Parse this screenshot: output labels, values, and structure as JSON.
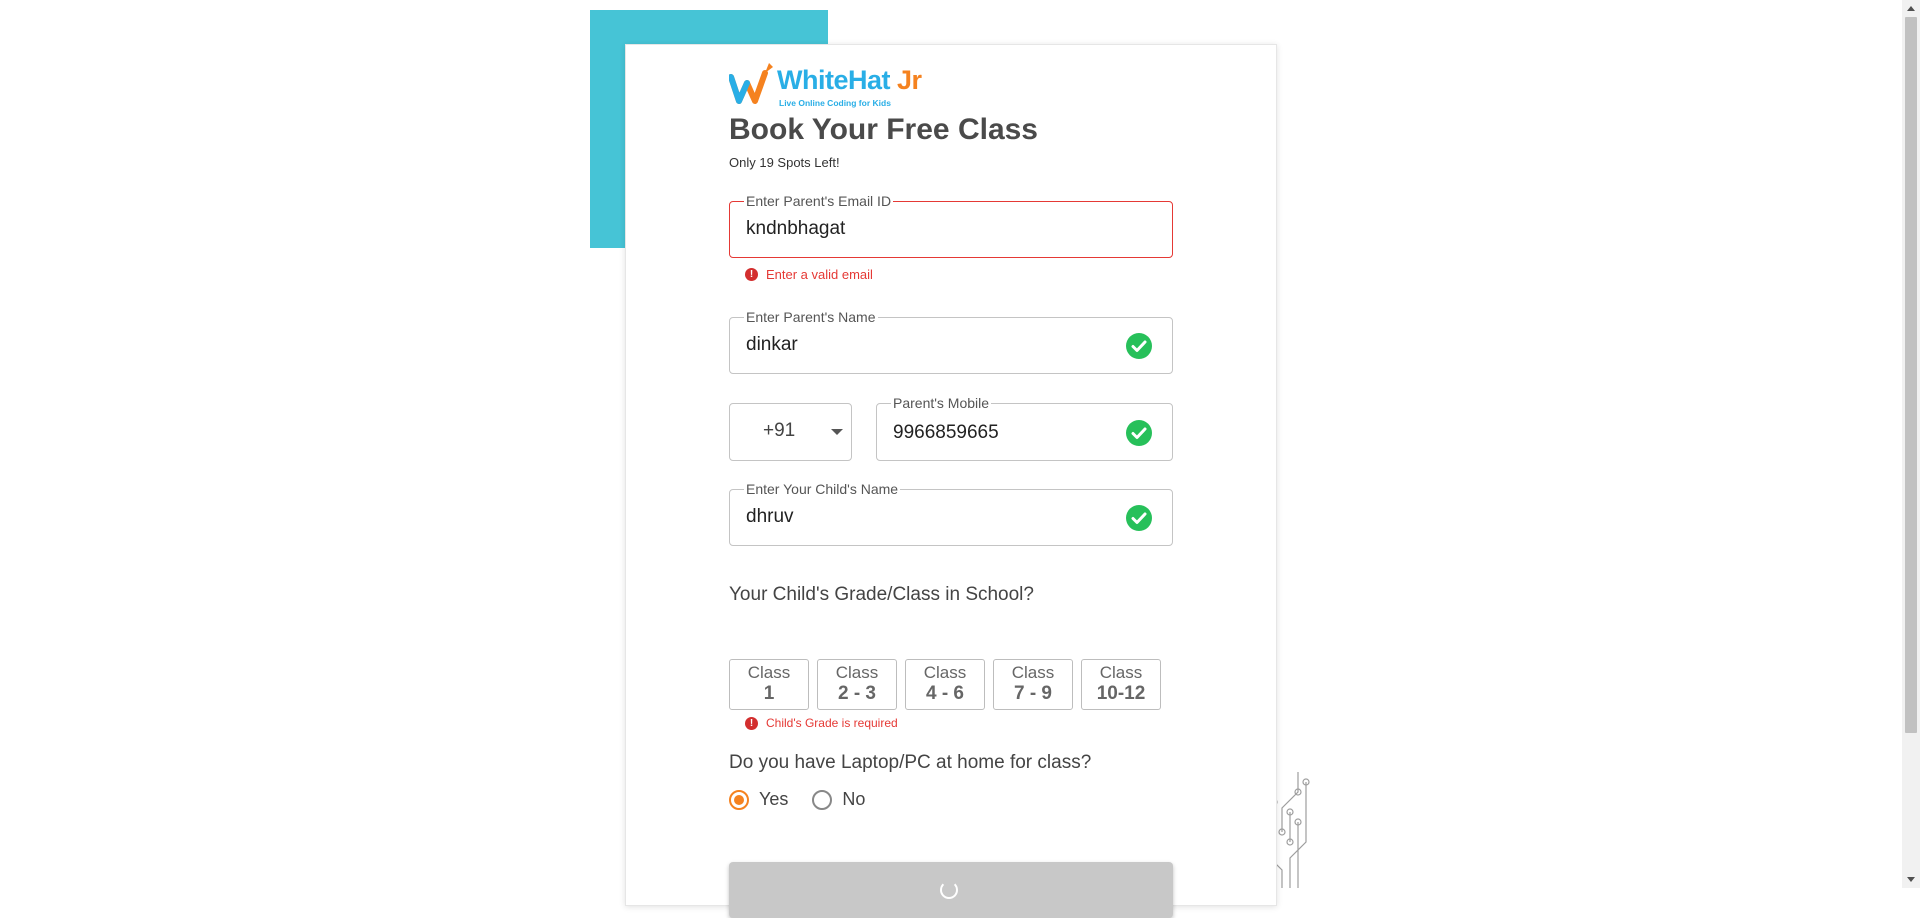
{
  "brand": {
    "name_main": "WhiteHat",
    "name_accent": "Jr",
    "tagline": "Live Online Coding for Kids",
    "primary_color": "#29aee6",
    "accent_color": "#f5821f",
    "teal_color": "#46c4d6"
  },
  "form": {
    "title": "Book Your Free Class",
    "subtitle": "Only 19 Spots Left!",
    "email": {
      "label": "Enter Parent's Email ID",
      "value": "kndnbhagat",
      "error": "Enter a valid email"
    },
    "parent_name": {
      "label": "Enter Parent's Name",
      "value": "dinkar",
      "valid": true
    },
    "country_code": {
      "value": "+91"
    },
    "mobile": {
      "label": "Parent's Mobile",
      "value": "9966859665",
      "valid": true
    },
    "child_name": {
      "label": "Enter Your Child's Name",
      "value": "dhruv",
      "valid": true
    },
    "grade": {
      "question": "Your Child's Grade/Class in School?",
      "options": [
        {
          "line1": "Class",
          "line2": "1"
        },
        {
          "line1": "Class",
          "line2": "2 - 3"
        },
        {
          "line1": "Class",
          "line2": "4 - 6"
        },
        {
          "line1": "Class",
          "line2": "7 - 9"
        },
        {
          "line1": "Class",
          "line2": "10-12"
        }
      ],
      "error": "Child's Grade is required"
    },
    "laptop": {
      "question": "Do you have Laptop/PC at home for class?",
      "options": [
        "Yes",
        "No"
      ],
      "selected": "Yes"
    },
    "submit": {
      "state": "loading"
    }
  },
  "colors": {
    "error": "#e53935",
    "valid": "#27c05a",
    "button_disabled": "#c8c8c8"
  }
}
